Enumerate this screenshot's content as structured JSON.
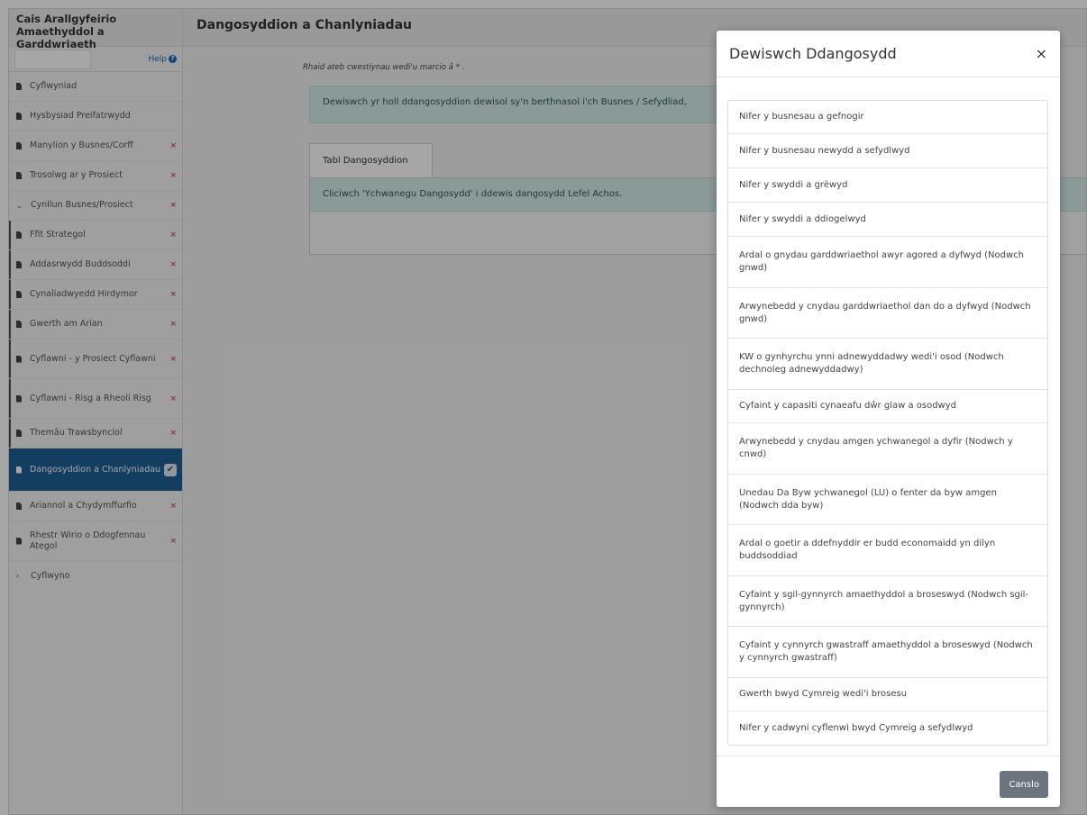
{
  "app": {
    "title": "Cais Arallgyfeirio Amaethyddol a Garddwriaeth"
  },
  "sidebar": {
    "help_label": "Help",
    "items": [
      {
        "label": "Cyflwyniad",
        "status": ""
      },
      {
        "label": "Hysbysiad Preifatrwydd",
        "status": ""
      },
      {
        "label": "Manylion y Busnes/Corff",
        "status": "×"
      },
      {
        "label": "Trosolwg ar y Prosiect",
        "status": "×"
      },
      {
        "label": "Cynllun Busnes/Prosiect",
        "status": "×"
      },
      {
        "label": "Ffit Strategol",
        "status": "×"
      },
      {
        "label": "Addasrwydd Buddsoddi",
        "status": "×"
      },
      {
        "label": "Cynaliadwyedd Hirdymor",
        "status": "×"
      },
      {
        "label": "Gwerth am Arian",
        "status": "×"
      },
      {
        "label": "Cyflawni - y Prosiect Cyflawni",
        "status": "×"
      },
      {
        "label": "Cyflawni - Risg a Rheoli Risg",
        "status": "×"
      },
      {
        "label": "Themâu Trawsbynciol",
        "status": "×"
      },
      {
        "label": "Dangosyddion a Chanlyniadau",
        "status": "✔"
      },
      {
        "label": "Ariannol a Chydymffurfio",
        "status": "×"
      },
      {
        "label": "Rhestr Wirio o Ddogfennau Ategol",
        "status": "×"
      },
      {
        "label": "Cyflwyno",
        "status": ""
      }
    ]
  },
  "main": {
    "title": "Dangosyddion a Chanlyniadau",
    "required_note": "Rhaid ateb cwestiynau wedi'u marcio â * .",
    "info_text": "Dewiswch yr holl ddangosyddion dewisol sy'n berthnasol i'ch Busnes / Sefydliad,",
    "tab_label": "Tabl Dangosyddion",
    "tab_info": "Cliciwch 'Ychwanegu Dangosydd' i ddewis dangosydd Lefel Achos."
  },
  "modal": {
    "title": "Dewiswch Ddangosydd",
    "close_label": "×",
    "options": [
      "Nifer y busnesau a gefnogir",
      "Nifer y busnesau newydd a sefydlwyd",
      "Nifer y swyddi a grëwyd",
      "Nifer y swyddi a ddiogelwyd",
      "Ardal o gnydau garddwriaethol awyr agored a dyfwyd (Nodwch gnwd)",
      "Arwynebedd y cnydau garddwriaethol dan do a dyfwyd (Nodwch gnwd)",
      "KW o gynhyrchu ynni adnewyddadwy wedi'i osod (Nodwch dechnoleg adnewyddadwy)",
      "Cyfaint y capasiti cynaeafu dŵr glaw a osodwyd",
      "Arwynebedd y cnydau amgen ychwanegol a dyfir (Nodwch y cnwd)",
      "Unedau Da Byw ychwanegol (LU) o fenter da byw amgen (Nodwch dda byw)",
      "Ardal o goetir a ddefnyddir er budd economaidd yn dilyn buddsoddiad",
      "Cyfaint y sgil-gynnyrch amaethyddol a broseswyd (Nodwch sgil-gynnyrch)",
      "Cyfaint y cynnyrch gwastraff amaethyddol a broseswyd (Nodwch y cynnyrch gwastraff)",
      "Gwerth bwyd Cymreig wedi'i brosesu",
      "Nifer y cadwyni cyflenwi bwyd Cymreig a sefydlwyd"
    ],
    "cancel_label": "Canslo"
  }
}
